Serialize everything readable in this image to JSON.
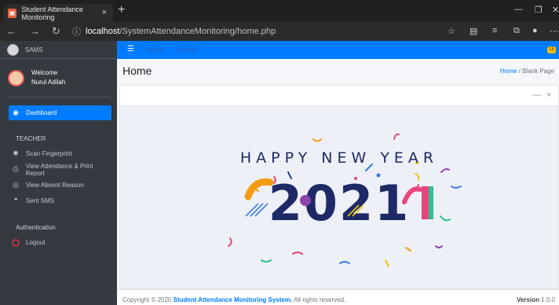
{
  "browser": {
    "tab_title": "Student Attendance Monitoring",
    "tab_close": "×",
    "new_tab": "+",
    "url_host": "localhost",
    "url_path": "/SystemAttendanceMonitoring/home.php"
  },
  "brand": {
    "name": "SAMS"
  },
  "user": {
    "welcome": "Welcome",
    "name": "Nurul Adilah"
  },
  "sidebar": {
    "dashboard": "Dashboard",
    "section_teacher": "TEACHER",
    "items": [
      {
        "label": "Scan Fingerprint",
        "icon": "fingerprint-icon"
      },
      {
        "label": "View Attendance & Print Report",
        "icon": "print-icon"
      },
      {
        "label": "View Absent Reason",
        "icon": "eye-icon"
      },
      {
        "label": "Sent SMS",
        "icon": "chat-icon"
      }
    ],
    "section_auth": "Authentication",
    "logout": "Logout"
  },
  "topnav": {
    "home": "Home",
    "contact": "Contact",
    "badge": "15"
  },
  "page": {
    "title": "Home",
    "breadcrumb_home": "Home",
    "breadcrumb_sep": "/",
    "breadcrumb_current": "Blank Page"
  },
  "card": {
    "minimize": "—",
    "close": "×"
  },
  "banner": {
    "line1": "HAPPY NEW YEAR",
    "year": "2021"
  },
  "footer": {
    "copyright_prefix": "Copyright © 2020",
    "system_name": "Student Attendance Monitoring System.",
    "rights": "All rights reserved.",
    "version_label": "Version",
    "version_value": "1.0.0"
  },
  "colors": {
    "primary": "#007bff",
    "sidebar": "#343a40",
    "accent_yellow": "#ffc107"
  }
}
